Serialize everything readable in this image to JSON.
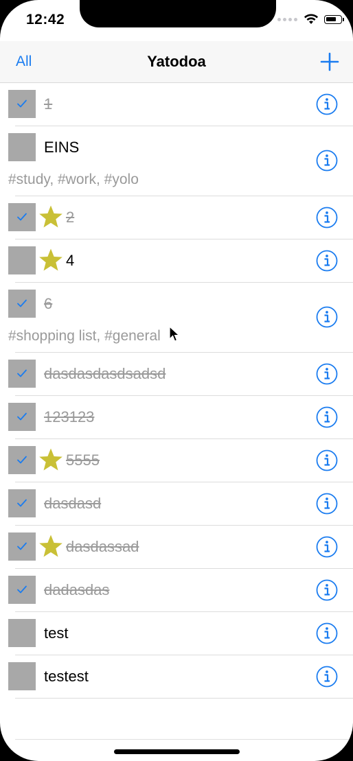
{
  "status_bar": {
    "time": "12:42"
  },
  "nav": {
    "left_label": "All",
    "title": "Yatodoa"
  },
  "colors": {
    "accent": "#1a7cf0",
    "star": "#c9c036",
    "checkbox": "#a8a8a8",
    "done_text": "#9a9a9a"
  },
  "todos": [
    {
      "title": "1",
      "done": true,
      "starred": false,
      "tags": ""
    },
    {
      "title": "EINS",
      "done": false,
      "starred": false,
      "tags": "#study, #work, #yolo"
    },
    {
      "title": "2",
      "done": true,
      "starred": true,
      "tags": ""
    },
    {
      "title": "4",
      "done": false,
      "starred": true,
      "tags": ""
    },
    {
      "title": "6",
      "done": true,
      "starred": false,
      "tags": "#shopping list, #general"
    },
    {
      "title": "dasdasdasdsadsd",
      "done": true,
      "starred": false,
      "tags": ""
    },
    {
      "title": "123123",
      "done": true,
      "starred": false,
      "tags": ""
    },
    {
      "title": "5555",
      "done": true,
      "starred": true,
      "tags": ""
    },
    {
      "title": "dasdasd",
      "done": true,
      "starred": false,
      "tags": ""
    },
    {
      "title": "dasdassad",
      "done": true,
      "starred": true,
      "tags": ""
    },
    {
      "title": "dadasdas",
      "done": true,
      "starred": false,
      "tags": ""
    },
    {
      "title": "test",
      "done": false,
      "starred": false,
      "tags": ""
    },
    {
      "title": "testest",
      "done": false,
      "starred": false,
      "tags": ""
    }
  ]
}
